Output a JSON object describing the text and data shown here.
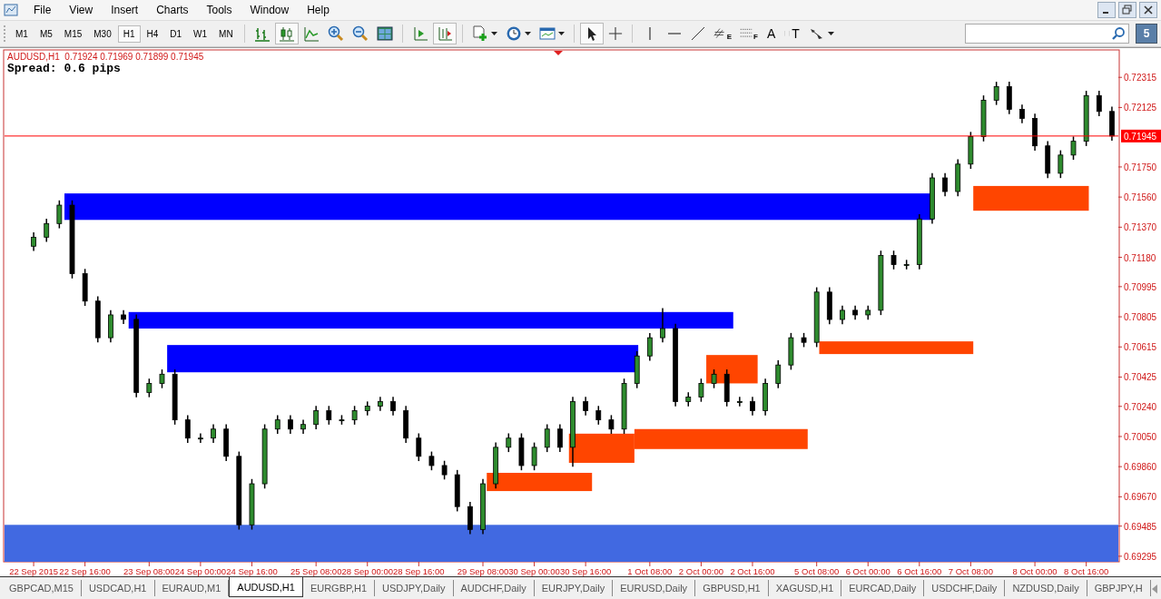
{
  "menu": {
    "items": [
      "File",
      "View",
      "Insert",
      "Charts",
      "Tools",
      "Window",
      "Help"
    ]
  },
  "toolbar": {
    "timeframes": [
      {
        "label": "M1",
        "selected": false
      },
      {
        "label": "M5",
        "selected": false
      },
      {
        "label": "M15",
        "selected": false
      },
      {
        "label": "M30",
        "selected": false
      },
      {
        "label": "H1",
        "selected": true
      },
      {
        "label": "H4",
        "selected": false
      },
      {
        "label": "D1",
        "selected": false
      },
      {
        "label": "W1",
        "selected": false
      },
      {
        "label": "MN",
        "selected": false
      }
    ],
    "groups": [
      [
        {
          "kind": "bar-chart",
          "pressed": false
        },
        {
          "kind": "candle-chart",
          "pressed": true
        },
        {
          "kind": "line-chart",
          "pressed": false
        },
        {
          "kind": "zoom-in",
          "pressed": false
        },
        {
          "kind": "zoom-out",
          "pressed": false
        },
        {
          "kind": "tile",
          "pressed": false
        }
      ],
      [
        {
          "kind": "autoscroll",
          "pressed": false
        },
        {
          "kind": "chart-shift",
          "pressed": true
        }
      ],
      [
        {
          "kind": "new-order",
          "pressed": false,
          "dropdown": true
        },
        {
          "kind": "periods",
          "pressed": false,
          "dropdown": true
        },
        {
          "kind": "templates",
          "pressed": false,
          "dropdown": true
        }
      ],
      [
        {
          "kind": "cursor",
          "pressed": true
        },
        {
          "kind": "crosshair",
          "pressed": false
        }
      ],
      [
        {
          "kind": "vline",
          "pressed": false
        },
        {
          "kind": "hline",
          "pressed": false
        },
        {
          "kind": "trendline",
          "pressed": false
        },
        {
          "kind": "fibo-channel",
          "pressed": false,
          "label": "E"
        },
        {
          "kind": "fibo",
          "pressed": false,
          "label": "F"
        },
        {
          "kind": "text",
          "pressed": false,
          "label": "A"
        },
        {
          "kind": "text-label",
          "pressed": false,
          "label": "T"
        },
        {
          "kind": "arrows",
          "pressed": false,
          "dropdown": true
        }
      ]
    ]
  },
  "notifications": {
    "count": "5"
  },
  "chart": {
    "symbol": "AUDUSD,H1",
    "ohlc": "0.71924 0.71969 0.71899 0.71945",
    "spread": "Spread: 0.6 pips",
    "chart_data": {
      "type": "candlestick",
      "categories": [
        "22 Sep 2015",
        null,
        null,
        null,
        "22 Sep 16:00",
        null,
        null,
        null,
        null,
        "23 Sep 08:00",
        null,
        null,
        null,
        "24 Sep 00:00",
        null,
        null,
        null,
        "24 Sep 16:00",
        null,
        null,
        null,
        null,
        "25 Sep 08:00",
        null,
        null,
        null,
        "28 Sep 00:00",
        null,
        null,
        null,
        "28 Sep 16:00",
        null,
        null,
        null,
        null,
        "29 Sep 08:00",
        null,
        null,
        null,
        "30 Sep 00:00",
        null,
        null,
        null,
        "30 Sep 16:00",
        null,
        null,
        null,
        null,
        "1 Oct 08:00",
        null,
        null,
        null,
        "2 Oct 00:00",
        null,
        null,
        null,
        "2 Oct 16:00",
        null,
        null,
        null,
        null,
        "5 Oct 08:00",
        null,
        null,
        null,
        "6 Oct 00:00",
        null,
        null,
        null,
        "6 Oct 16:00",
        null,
        null,
        null,
        "7 Oct 08:00",
        null,
        null,
        null,
        null,
        "8 Oct 00:00",
        null,
        null,
        null,
        "8 Oct 16:00",
        null,
        null
      ],
      "ohlc": [
        [
          0.7125,
          0.71337,
          0.7122,
          0.71307
        ],
        [
          0.71307,
          0.71423,
          0.71277,
          0.71393
        ],
        [
          0.71393,
          0.71539,
          0.71363,
          0.71509
        ],
        [
          0.71509,
          0.71539,
          0.71047,
          0.71077
        ],
        [
          0.71077,
          0.71107,
          0.70874,
          0.70904
        ],
        [
          0.70904,
          0.70934,
          0.70643,
          0.70673
        ],
        [
          0.70673,
          0.70847,
          0.70643,
          0.70817
        ],
        [
          0.70817,
          0.70847,
          0.70759,
          0.70789
        ],
        [
          0.70789,
          0.70819,
          0.70298,
          0.70328
        ],
        [
          0.70328,
          0.70415,
          0.70298,
          0.70385
        ],
        [
          0.70385,
          0.70473,
          0.70355,
          0.70443
        ],
        [
          0.70443,
          0.70473,
          0.70125,
          0.70155
        ],
        [
          0.70155,
          0.70185,
          0.7001,
          0.7004
        ],
        [
          0.7004,
          0.7007,
          0.7001,
          0.7004
        ],
        [
          0.7004,
          0.70127,
          0.7001,
          0.70097
        ],
        [
          0.70097,
          0.70127,
          0.69895,
          0.69925
        ],
        [
          0.69925,
          0.69955,
          0.69463,
          0.69493
        ],
        [
          0.69493,
          0.69782,
          0.69463,
          0.69752
        ],
        [
          0.69752,
          0.70127,
          0.69722,
          0.70097
        ],
        [
          0.70097,
          0.70185,
          0.70067,
          0.70155
        ],
        [
          0.70155,
          0.70185,
          0.70067,
          0.70097
        ],
        [
          0.70097,
          0.70156,
          0.70067,
          0.70126
        ],
        [
          0.70126,
          0.70243,
          0.70096,
          0.70213
        ],
        [
          0.70213,
          0.70243,
          0.70125,
          0.70155
        ],
        [
          0.70155,
          0.70185,
          0.70125,
          0.70155
        ],
        [
          0.70155,
          0.70243,
          0.70125,
          0.70213
        ],
        [
          0.70213,
          0.70271,
          0.70183,
          0.70241
        ],
        [
          0.70241,
          0.703,
          0.70211,
          0.7027
        ],
        [
          0.7027,
          0.703,
          0.70183,
          0.70213
        ],
        [
          0.70213,
          0.70243,
          0.7001,
          0.7004
        ],
        [
          0.7004,
          0.7007,
          0.69895,
          0.69925
        ],
        [
          0.69925,
          0.69955,
          0.69837,
          0.69867
        ],
        [
          0.69867,
          0.69897,
          0.69779,
          0.69809
        ],
        [
          0.69809,
          0.69839,
          0.69578,
          0.69608
        ],
        [
          0.69608,
          0.69638,
          0.69434,
          0.69464
        ],
        [
          0.69464,
          0.69782,
          0.69434,
          0.69752
        ],
        [
          0.69752,
          0.70012,
          0.69722,
          0.69982
        ],
        [
          0.69982,
          0.7007,
          0.69952,
          0.7004
        ],
        [
          0.7004,
          0.7007,
          0.69837,
          0.69867
        ],
        [
          0.69867,
          0.70012,
          0.69837,
          0.69982
        ],
        [
          0.69982,
          0.70127,
          0.69952,
          0.70097
        ],
        [
          0.70097,
          0.70127,
          0.69952,
          0.69982
        ],
        [
          0.69982,
          0.703,
          0.6986,
          0.7027
        ],
        [
          0.7027,
          0.703,
          0.70183,
          0.70213
        ],
        [
          0.70213,
          0.70243,
          0.70125,
          0.70155
        ],
        [
          0.70155,
          0.70185,
          0.70067,
          0.70097
        ],
        [
          0.70097,
          0.70415,
          0.70067,
          0.70385
        ],
        [
          0.70385,
          0.70588,
          0.70355,
          0.70558
        ],
        [
          0.70558,
          0.70703,
          0.70528,
          0.70673
        ],
        [
          0.70673,
          0.7086,
          0.70643,
          0.70731
        ],
        [
          0.70731,
          0.70761,
          0.7024,
          0.7027
        ],
        [
          0.7027,
          0.70329,
          0.7024,
          0.70299
        ],
        [
          0.70299,
          0.70415,
          0.70269,
          0.70385
        ],
        [
          0.70385,
          0.70473,
          0.70355,
          0.70443
        ],
        [
          0.70443,
          0.70473,
          0.7024,
          0.7027
        ],
        [
          0.7027,
          0.703,
          0.7024,
          0.7027
        ],
        [
          0.7027,
          0.703,
          0.70183,
          0.70213
        ],
        [
          0.70213,
          0.70415,
          0.70183,
          0.70385
        ],
        [
          0.70385,
          0.70531,
          0.70355,
          0.70501
        ],
        [
          0.70501,
          0.70703,
          0.70471,
          0.70673
        ],
        [
          0.70673,
          0.70703,
          0.70614,
          0.70644
        ],
        [
          0.70644,
          0.70991,
          0.70614,
          0.70961
        ],
        [
          0.70961,
          0.70991,
          0.70758,
          0.70788
        ],
        [
          0.70788,
          0.70876,
          0.70758,
          0.70846
        ],
        [
          0.70846,
          0.70876,
          0.70787,
          0.70817
        ],
        [
          0.70817,
          0.70876,
          0.70787,
          0.70846
        ],
        [
          0.70846,
          0.71222,
          0.70816,
          0.71192
        ],
        [
          0.71192,
          0.71222,
          0.71104,
          0.71134
        ],
        [
          0.71134,
          0.71164,
          0.71104,
          0.71134
        ],
        [
          0.71134,
          0.71452,
          0.71104,
          0.71422
        ],
        [
          0.71422,
          0.71711,
          0.71392,
          0.71681
        ],
        [
          0.71681,
          0.71711,
          0.71565,
          0.71595
        ],
        [
          0.71595,
          0.71798,
          0.71565,
          0.71768
        ],
        [
          0.71768,
          0.71971,
          0.71738,
          0.71941
        ],
        [
          0.71941,
          0.72201,
          0.71911,
          0.72171
        ],
        [
          0.72171,
          0.72287,
          0.72141,
          0.72257
        ],
        [
          0.72257,
          0.72287,
          0.72083,
          0.72113
        ],
        [
          0.72113,
          0.72143,
          0.72026,
          0.72056
        ],
        [
          0.72056,
          0.72086,
          0.71853,
          0.71883
        ],
        [
          0.71883,
          0.71913,
          0.7168,
          0.7171
        ],
        [
          0.7171,
          0.71855,
          0.7168,
          0.71825
        ],
        [
          0.71825,
          0.71942,
          0.71795,
          0.71912
        ],
        [
          0.71912,
          0.7223,
          0.71882,
          0.722
        ],
        [
          0.722,
          0.7223,
          0.7207,
          0.721
        ],
        [
          0.721,
          0.7213,
          0.71915,
          0.71945
        ]
      ],
      "ylim": [
        0.6926,
        0.72488
      ],
      "yticks": [
        {
          "value": 0.72315,
          "label": "0.72315"
        },
        {
          "value": 0.72125,
          "label": "0.72125"
        },
        {
          "value": 0.7175,
          "label": "0.71750"
        },
        {
          "value": 0.7156,
          "label": "0.71560"
        },
        {
          "value": 0.7137,
          "label": "0.71370"
        },
        {
          "value": 0.7118,
          "label": "0.71180"
        },
        {
          "value": 0.70995,
          "label": "0.70995"
        },
        {
          "value": 0.70805,
          "label": "0.70805"
        },
        {
          "value": 0.70615,
          "label": "0.70615"
        },
        {
          "value": 0.70425,
          "label": "0.70425"
        },
        {
          "value": 0.7024,
          "label": "0.70240"
        },
        {
          "value": 0.7005,
          "label": "0.70050"
        },
        {
          "value": 0.6986,
          "label": "0.69860"
        },
        {
          "value": 0.6967,
          "label": "0.69670"
        },
        {
          "value": 0.69485,
          "label": "0.69485"
        },
        {
          "value": 0.69295,
          "label": "0.69295"
        }
      ],
      "bands": [
        {
          "axis": "y",
          "from": 0.71416,
          "to": 0.71583,
          "color": "#0000ff"
        },
        {
          "axis": "y",
          "from": 0.70731,
          "to": 0.70835,
          "color": "#0000ff"
        },
        {
          "axis": "y",
          "from": 0.70455,
          "to": 0.70627,
          "color": "#0000ff"
        },
        {
          "axis": "y",
          "from": 0.6926,
          "to": 0.69493,
          "color": "#4169e1"
        },
        {
          "axis": "y",
          "from": 0.69706,
          "to": 0.69821,
          "color": "#ff4500"
        },
        {
          "axis": "y",
          "from": 0.69884,
          "to": 0.70068,
          "color": "#ff4500"
        },
        {
          "axis": "y",
          "from": 0.69971,
          "to": 0.70097,
          "color": "#ff4500"
        },
        {
          "axis": "y",
          "from": 0.70385,
          "to": 0.70564,
          "color": "#ff4500"
        },
        {
          "axis": "y",
          "from": 0.7057,
          "to": 0.7065,
          "color": "#ff4500"
        },
        {
          "axis": "y",
          "from": 0.71474,
          "to": 0.7163,
          "color": "#ff4500"
        }
      ],
      "ref_lines": [
        {
          "axis": "y",
          "value": 0.71945,
          "label": "0.71945",
          "color": "#ff0000"
        }
      ]
    }
  },
  "tabs": [
    {
      "label": "GBPCAD,M15",
      "selected": false
    },
    {
      "label": "USDCAD,H1",
      "selected": false
    },
    {
      "label": "EURAUD,M1",
      "selected": false
    },
    {
      "label": "AUDUSD,H1",
      "selected": true
    },
    {
      "label": "EURGBP,H1",
      "selected": false
    },
    {
      "label": "USDJPY,Daily",
      "selected": false
    },
    {
      "label": "AUDCHF,Daily",
      "selected": false
    },
    {
      "label": "EURJPY,Daily",
      "selected": false
    },
    {
      "label": "EURUSD,Daily",
      "selected": false
    },
    {
      "label": "GBPUSD,H1",
      "selected": false
    },
    {
      "label": "XAGUSD,H1",
      "selected": false
    },
    {
      "label": "EURCAD,Daily",
      "selected": false
    },
    {
      "label": "USDCHF,Daily",
      "selected": false
    },
    {
      "label": "NZDUSD,Daily",
      "selected": false
    },
    {
      "label": "GBPJPY,H",
      "selected": false
    }
  ]
}
